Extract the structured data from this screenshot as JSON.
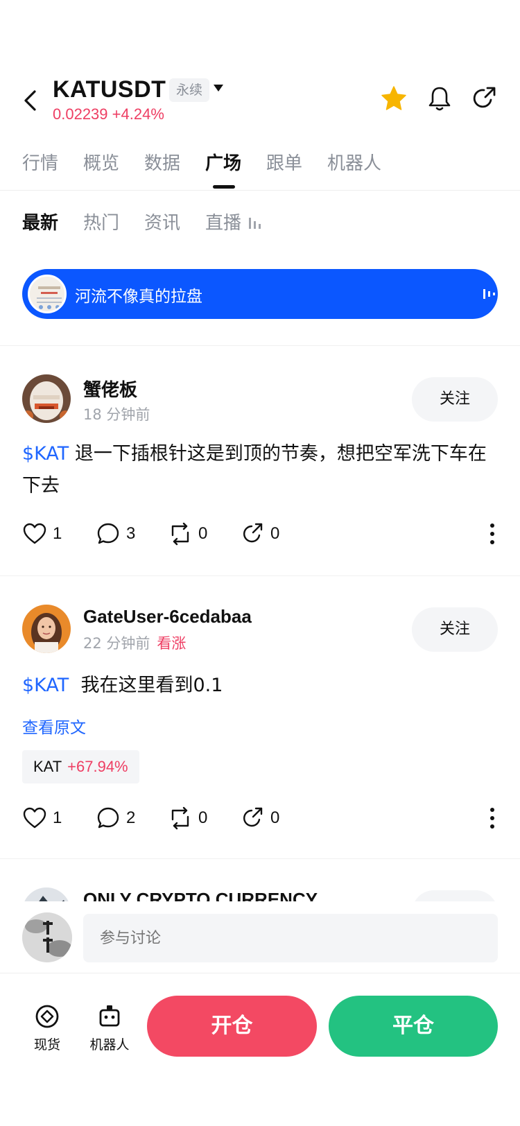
{
  "header": {
    "symbol": "KATUSDT",
    "contract_type": "永续",
    "price": "0.02239",
    "change": "+4.24%"
  },
  "tabs": [
    "行情",
    "概览",
    "数据",
    "广场",
    "跟单",
    "机器人"
  ],
  "active_tab": "广场",
  "subtabs": [
    "最新",
    "热门",
    "资讯",
    "直播"
  ],
  "active_subtab": "最新",
  "live_banner": {
    "title": "河流不像真的拉盘"
  },
  "posts": [
    {
      "author": "蟹佬板",
      "time": "18 分钟前",
      "follow_label": "关注",
      "tag": "$KAT",
      "text": " 退一下插根针这是到顶的节奏，想把空军洗下车在下去",
      "likes": "1",
      "comments": "3",
      "reposts": "0",
      "shares": "0"
    },
    {
      "author": "GateUser-6cedabaa",
      "time": "22 分钟前",
      "sentiment": "看涨",
      "follow_label": "关注",
      "tag": "$KAT",
      "text": "  我在这里看到0.1",
      "see_original": "查看原文",
      "coin": "KAT",
      "coin_change": "+67.94%",
      "likes": "1",
      "comments": "2",
      "reposts": "0",
      "shares": "0"
    },
    {
      "author": "ONLY CRYPTO CURRENCY"
    }
  ],
  "compose": {
    "placeholder": "参与讨论"
  },
  "bottom_nav": {
    "spot_label": "现货",
    "bot_label": "机器人",
    "open_label": "开仓",
    "close_label": "平仓"
  },
  "colors": {
    "up": "#ee3e63",
    "brand_blue": "#0b57ff",
    "open": "#f34963",
    "close": "#23c281",
    "star": "#f7b500"
  }
}
